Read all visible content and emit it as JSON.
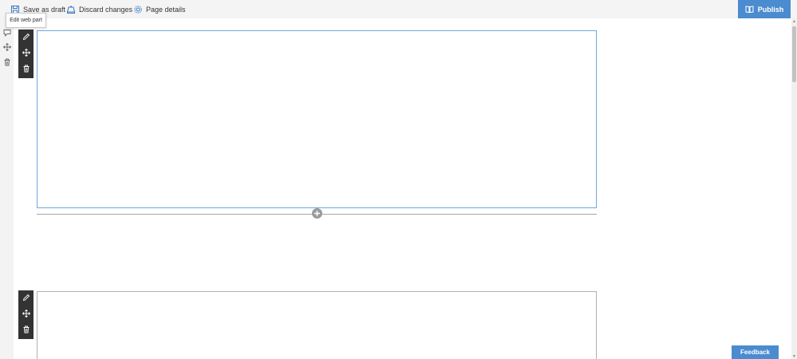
{
  "commandbar": {
    "save_draft_label": "Save as draft",
    "save_draft_icon": "save-icon",
    "discard_label": "Discard changes",
    "discard_icon": "discard-icon",
    "page_details_label": "Page details",
    "page_details_icon": "gear-icon",
    "publish_label": "Publish",
    "publish_icon": "book-icon"
  },
  "tooltip": {
    "text": "Edit web part"
  },
  "left_gutter": {
    "icons": [
      "comment-icon",
      "move-icon",
      "delete-icon"
    ]
  },
  "webparts": [
    {
      "state": "selected",
      "tools": [
        "edit-icon",
        "move-icon",
        "delete-icon"
      ]
    },
    {
      "state": "default",
      "tools": [
        "edit-icon",
        "move-icon",
        "delete-icon"
      ]
    }
  ],
  "section_divider": {
    "add_icon": "plus-icon"
  },
  "feedback": {
    "label": "Feedback"
  },
  "colors": {
    "accent": "#4b8bd0",
    "toolbar_dark": "#333333",
    "selected_border": "#6fa8dc",
    "commandbar_bg": "#f4f4f4"
  }
}
